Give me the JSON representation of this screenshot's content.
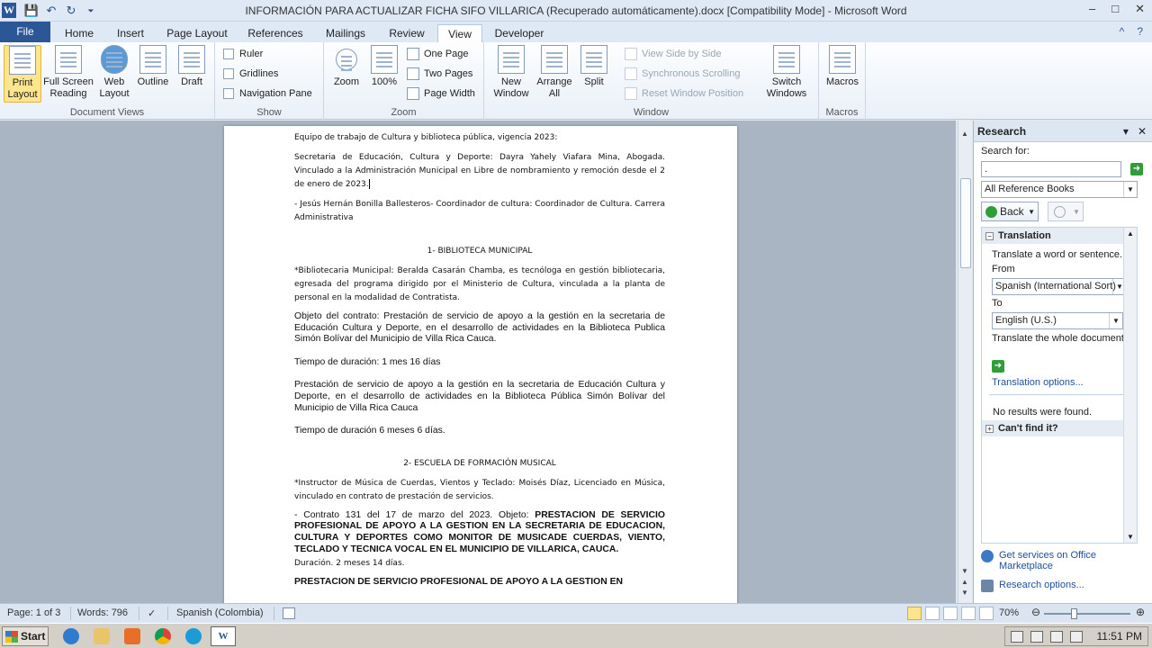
{
  "window": {
    "title": "INFORMACIÓN PARA ACTUALIZAR FICHA SIFO VILLARICA (Recuperado automáticamente).docx [Compatibility Mode] - Microsoft Word",
    "app_logo": "W",
    "controls": [
      "–",
      "□",
      "✕"
    ]
  },
  "qat": {
    "save": "💾",
    "undo": "↶",
    "redo": "↻",
    "customize": "⏷"
  },
  "tabs": [
    "File",
    "Home",
    "Insert",
    "Page Layout",
    "References",
    "Mailings",
    "Review",
    "View",
    "Developer"
  ],
  "active_tab": "View",
  "help_icons": [
    "^",
    "?"
  ],
  "ribbon": {
    "document_views": {
      "label": "Document Views",
      "buttons": [
        "Print Layout",
        "Full Screen Reading",
        "Web Layout",
        "Outline",
        "Draft"
      ]
    },
    "show": {
      "label": "Show",
      "checkboxes": [
        "Ruler",
        "Gridlines",
        "Navigation Pane"
      ]
    },
    "zoom": {
      "label": "Zoom",
      "zoom": "Zoom",
      "hundred": "100%",
      "one_page": "One Page",
      "two_pages": "Two Pages",
      "page_width": "Page Width"
    },
    "window": {
      "label": "Window",
      "new_window": "New Window",
      "arrange_all": "Arrange All",
      "split": "Split",
      "view_side": "View Side by Side",
      "sync_scroll": "Synchronous Scrolling",
      "reset_pos": "Reset Window Position",
      "switch": "Switch Windows"
    },
    "macros": {
      "label": "Macros",
      "macros": "Macros"
    }
  },
  "document": {
    "p1": "Equipo de trabajo de Cultura y biblioteca pública, vigencia 2023:",
    "p2": "Secretaria de Educación, Cultura y Deporte: Dayra Yahely Viafara Mina, Abogada. Vinculado a la Administración Municipal en Libre de nombramiento y remoción desde el 2 de enero de 2023.",
    "p3": "- Jesús Hernán Bonilla Ballesteros- Coordinador de cultura: Coordinador de Cultura. Carrera Administrativa",
    "h1": "1- BIBLIOTECA MUNICIPAL",
    "p4": "*Bibliotecaria Municipal: Beralda Casarán Chamba, es tecnóloga en gestión bibliotecaria, egresada del programa dirigido por el Ministerio de Cultura, vinculada a la planta de personal en la modalidad de Contratista.",
    "p5": "Objeto del contrato: Prestación de servicio de apoyo a la gestión en la secretaria de Educación Cultura y Deporte, en el desarrollo de actividades en la Biblioteca Publica Simón Bolívar del Municipio de Villa Rica Cauca.",
    "p6": "Tiempo de duración: 1 mes 16 días",
    "p7": "Prestación de servicio de apoyo a la gestión en la secretaria de Educación Cultura y Deporte, en el desarrollo de actividades en la Biblioteca Pública Simón Bolívar del Municipio de Villa Rica Cauca",
    "p8": "Tiempo de duración 6 meses 6 días.",
    "h2": "2- ESCUELA DE FORMACIÓN MUSICAL",
    "p9": "*Instructor de Música de Cuerdas, Vientos y Teclado: Moisés Díaz, Licenciado en Música, vinculado en contrato de prestación de servicios.",
    "p10a": "- Contrato 131 del 17 de marzo del 2023. Objeto: ",
    "p10b": "PRESTACION DE SERVICIO PROFESIONAL DE APOYO A LA GESTION EN LA SECRETARIA DE EDUCACION, CULTURA Y DEPORTES COMO MONITOR DE MUSICADE CUERDAS, VIENTO, TECLADO Y TECNICA VOCAL EN EL MUNICIPIO DE VILLARICA, CAUCA.",
    "p11": "Duración. 2 meses 14 días.",
    "p12": "PRESTACION DE SERVICIO PROFESIONAL DE APOYO A LA GESTION EN"
  },
  "research": {
    "title": "Research",
    "search_label": "Search for:",
    "search_value": ".",
    "source": "All Reference Books",
    "back": "Back",
    "section": "Translation",
    "translate_text": "Translate a word or sentence.",
    "from_label": "From",
    "from_value": "Spanish (International Sort)",
    "to_label": "To",
    "to_value": "English (U.S.)",
    "translate_doc": "Translate the whole document.",
    "options_link": "Translation options...",
    "no_results": "No results were found.",
    "cant_find": "Can't find it?",
    "get_services": "Get services on Office Marketplace",
    "research_options": "Research options..."
  },
  "status": {
    "page": "Page: 1 of 3",
    "words": "Words: 796",
    "language": "Spanish (Colombia)",
    "zoom": "70%"
  },
  "taskbar": {
    "start": "Start",
    "time": "11:51 PM"
  }
}
